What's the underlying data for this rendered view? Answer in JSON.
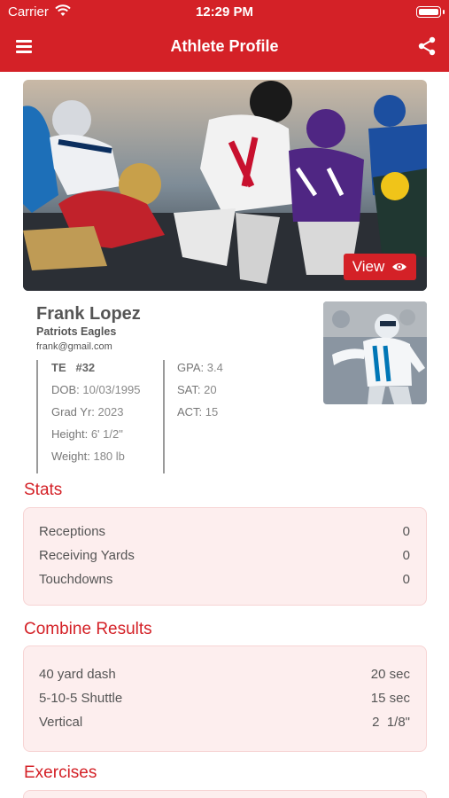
{
  "status_bar": {
    "carrier": "Carrier",
    "time": "12:29 PM"
  },
  "nav": {
    "title": "Athlete Profile"
  },
  "hero": {
    "view_label": "View"
  },
  "profile": {
    "name": "Frank Lopez",
    "team": "Patriots Eagles",
    "email": "frank@gmail.com",
    "position": "TE",
    "number": "#32",
    "dob_label": "DOB:",
    "dob": "10/03/1995",
    "grad_label": "Grad Yr:",
    "grad": "2023",
    "height_label": "Height:",
    "height": "6' 1/2\"",
    "weight_label": "Weight:",
    "weight": "180 lb",
    "gpa_label": "GPA:",
    "gpa": "3.4",
    "sat_label": "SAT:",
    "sat": "20",
    "act_label": "ACT:",
    "act": "15"
  },
  "stats": {
    "title": "Stats",
    "rows": [
      {
        "label": "Receptions",
        "value": "0"
      },
      {
        "label": "Receiving Yards",
        "value": "0"
      },
      {
        "label": "Touchdowns",
        "value": "0"
      }
    ]
  },
  "combine": {
    "title": "Combine Results",
    "rows": [
      {
        "label": "40 yard dash",
        "value": "20 sec"
      },
      {
        "label": "5-10-5 Shuttle",
        "value": "15 sec"
      },
      {
        "label": "Vertical",
        "value": "2  1/8\""
      }
    ]
  },
  "exercises": {
    "title": "Exercises"
  },
  "colors": {
    "accent": "#d42127",
    "card_bg": "#fdeeee"
  },
  "icons": {
    "menu": "hamburger-icon",
    "share": "share-icon",
    "view": "eye-icon"
  }
}
